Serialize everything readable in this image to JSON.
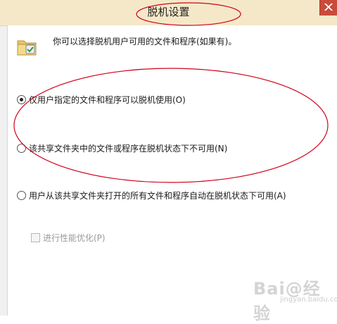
{
  "window": {
    "title": "脱机设置"
  },
  "intro": {
    "text": "你可以选择脱机用户可用的文件和程序(如果有)。"
  },
  "options": [
    {
      "label": "仅用户指定的文件和程序可以脱机使用(O)",
      "checked": true
    },
    {
      "label": "该共享文件夹中的文件或程序在脱机状态下不可用(N)",
      "checked": false
    },
    {
      "label": "用户从该共享文件夹打开的所有文件和程序自动在脱机状态下可用(A)",
      "checked": false
    }
  ],
  "performance": {
    "label": "进行性能优化(P)",
    "checked": false,
    "enabled": false
  },
  "watermark": {
    "brand": "Bai@经验",
    "domain": "jingyan.baidu.com"
  },
  "colors": {
    "titlebar": "#f5e8c8",
    "annotation": "#d0021b",
    "close": "#c94c3b"
  }
}
